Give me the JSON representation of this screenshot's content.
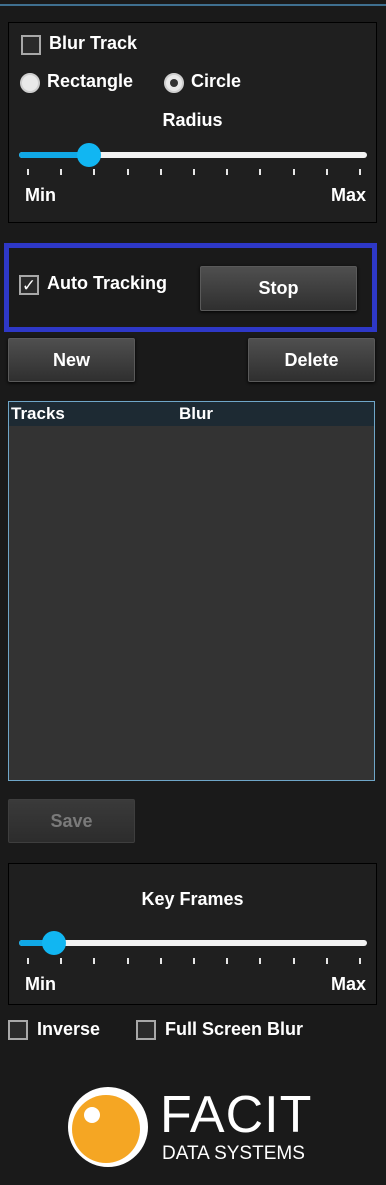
{
  "blur_panel": {
    "blur_track_label": "Blur Track",
    "blur_track_checked": false,
    "shape_options": [
      "Rectangle",
      "Circle"
    ],
    "selected_shape": "Circle",
    "radius_label": "Radius",
    "radius_value": 0.2,
    "min_label": "Min",
    "max_label": "Max"
  },
  "tracking": {
    "auto_tracking_label": "Auto Tracking",
    "auto_tracking_checked": true,
    "stop_label": "Stop"
  },
  "actions": {
    "new_label": "New",
    "delete_label": "Delete"
  },
  "tracks_table": {
    "columns": [
      "Tracks",
      "Blur"
    ],
    "rows": []
  },
  "save_label": "Save",
  "keyframes": {
    "label": "Key Frames",
    "value": 0.1,
    "min_label": "Min",
    "max_label": "Max"
  },
  "options": {
    "inverse_label": "Inverse",
    "inverse_checked": false,
    "full_screen_blur_label": "Full Screen Blur",
    "full_screen_blur_checked": false
  },
  "logo": {
    "name": "FACIT",
    "tagline": "DATA SYSTEMS",
    "accent_color": "#f5a623"
  },
  "colors": {
    "accent": "#11b6f2",
    "highlight": "#2e38c7"
  }
}
